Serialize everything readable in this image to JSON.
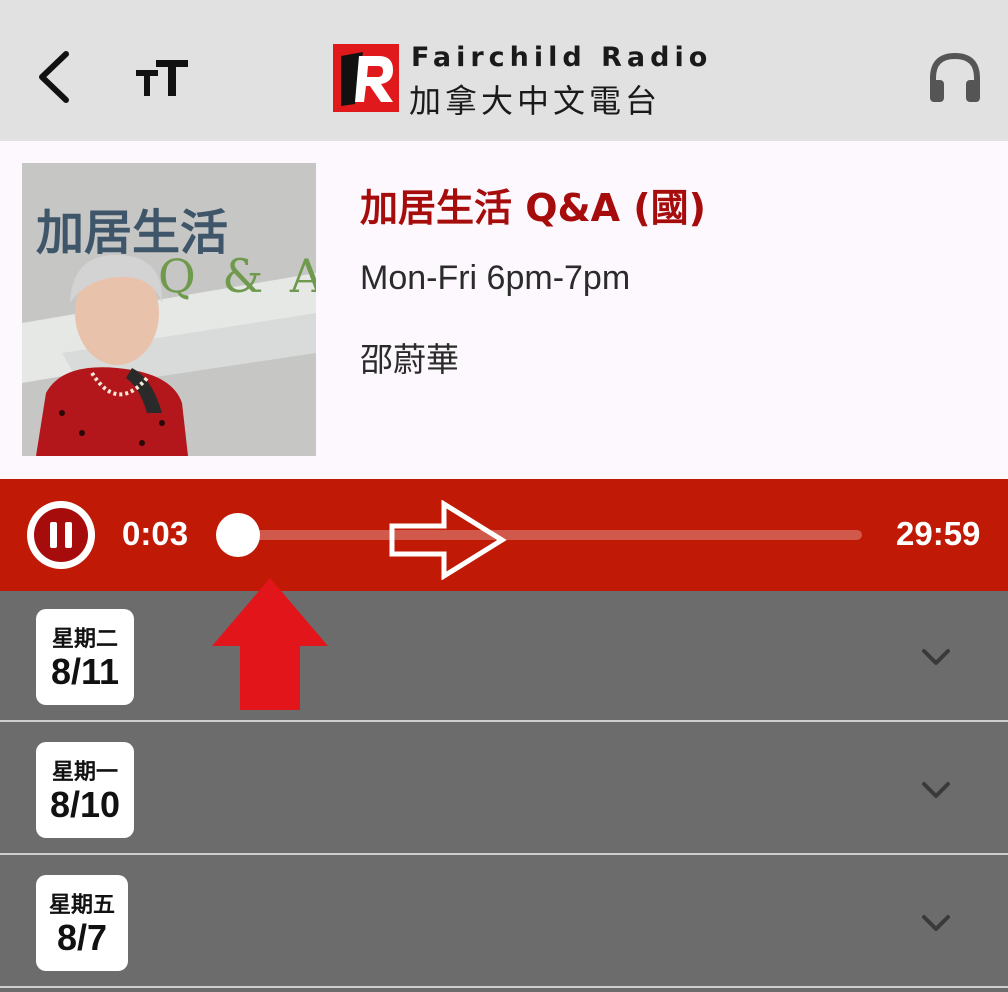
{
  "header": {
    "back_icon": "back-arrow-icon",
    "font_size_icon": "text-size-icon",
    "logo_en": "Fairchild Radio",
    "logo_zh": "加拿大中文電台",
    "listen_icon": "headphones-icon"
  },
  "program": {
    "artwork_title": "加居生活",
    "artwork_subtitle": "Q & A",
    "title": "加居生活 Q&A (國)",
    "schedule": "Mon-Fri 6pm-7pm",
    "host": "邵蔚華"
  },
  "player": {
    "current_time": "0:03",
    "total_time": "29:59",
    "progress": 0.0,
    "state_icon": "pause-icon",
    "accent": "#c01a07"
  },
  "episodes": [
    {
      "weekday": "星期二",
      "date": "8/11"
    },
    {
      "weekday": "星期一",
      "date": "8/10"
    },
    {
      "weekday": "星期五",
      "date": "8/7"
    }
  ],
  "colors": {
    "title_red": "#a60c0c",
    "annotation_red": "#e2151b",
    "list_bg": "#6c6c6c"
  }
}
